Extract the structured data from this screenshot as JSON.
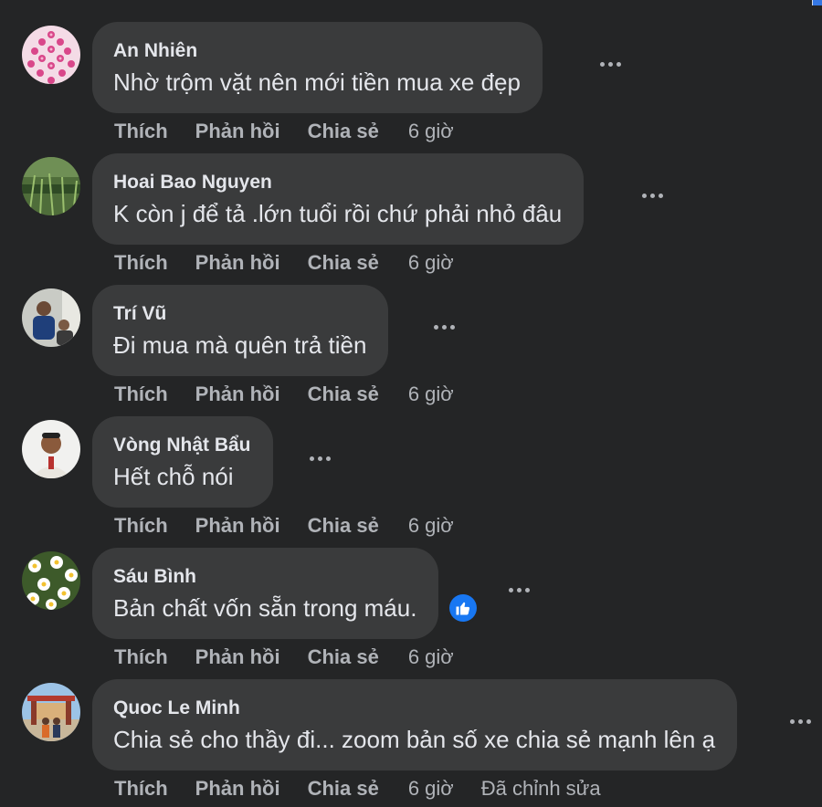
{
  "actions": {
    "like": "Thích",
    "reply": "Phản hồi",
    "share": "Chia sẻ"
  },
  "colors": {
    "background": "#242526",
    "bubble": "#3a3b3c",
    "text": "#e4e6eb",
    "secondary_text": "#b0b3b8",
    "like_blue": "#1877f2"
  },
  "comments": [
    {
      "author": "An Nhiên",
      "text": "Nhờ trộm vặt nên mới tiền mua xe đẹp",
      "time": "6 giờ"
    },
    {
      "author": "Hoai Bao Nguyen",
      "text": "K còn j để tả .lớn tuổi rồi chứ phải nhỏ đâu",
      "time": "6 giờ"
    },
    {
      "author": "Trí Vũ",
      "text": "Đi mua mà quên trả tiền",
      "time": "6 giờ"
    },
    {
      "author": "Vòng Nhật Bẩu",
      "text": "Hết chỗ nói",
      "time": "6 giờ"
    },
    {
      "author": "Sáu Bình",
      "text": "Bản chất vốn sẵn trong máu.",
      "time": "6 giờ",
      "reaction_icon": "like-icon"
    },
    {
      "author": "Quoc Le Minh",
      "text": "Chia sẻ cho thầy đi... zoom bản số xe chia sẻ mạnh lên ạ",
      "time": "6 giờ",
      "edited_label": "Đã chỉnh sửa"
    }
  ]
}
